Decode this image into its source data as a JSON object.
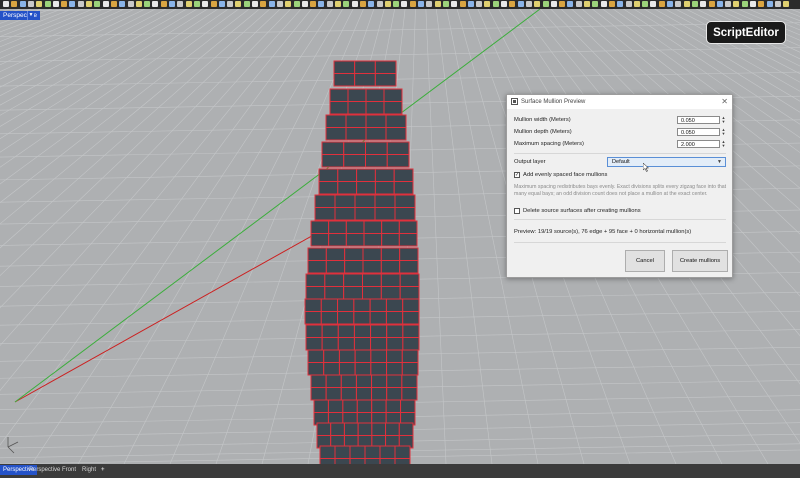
{
  "viewport": {
    "active_label": "Perspective"
  },
  "tabs": [
    {
      "label": "Perspective",
      "active": true
    },
    {
      "label": "Perspective",
      "active": false
    },
    {
      "label": "Front",
      "active": false
    },
    {
      "label": "Right",
      "active": false
    },
    {
      "label": "+",
      "active": false
    }
  ],
  "badge": {
    "label": "ScriptEditor"
  },
  "dialog": {
    "title": "Surface Mullion Preview",
    "close_glyph": "✕",
    "mullion_width_label": "Mullion width (Meters)",
    "mullion_width_value": "0.050",
    "mullion_depth_label": "Mullion depth (Meters)",
    "mullion_depth_value": "0.050",
    "max_spacing_label": "Maximum spacing (Meters)",
    "max_spacing_value": "2.000",
    "output_layer_label": "Output layer",
    "output_layer_value": "Default",
    "add_mullions_label": "Add evenly spaced face mullions",
    "add_mullions_checked": true,
    "hint": "Maximum spacing redistributes bays evenly. Exact divisions splits every zigzag face into that many equal bays; an odd division count does not place a mullion at the exact center.",
    "delete_sources_label": "Delete source surfaces after creating mullions",
    "delete_sources_checked": false,
    "preview_text": "Preview: 19/19 source(s), 76 edge + 95 face + 0 horizontal mullion(s)",
    "cancel_label": "Cancel",
    "create_label": "Create mullions"
  },
  "colors": {
    "panel_fill": "#3b4750",
    "panel_edge": "#e0303c",
    "grid_line": "#c4c6c8",
    "axis_green": "#3cae3c",
    "axis_red": "#cc2020",
    "active_tab": "#2452c8"
  }
}
